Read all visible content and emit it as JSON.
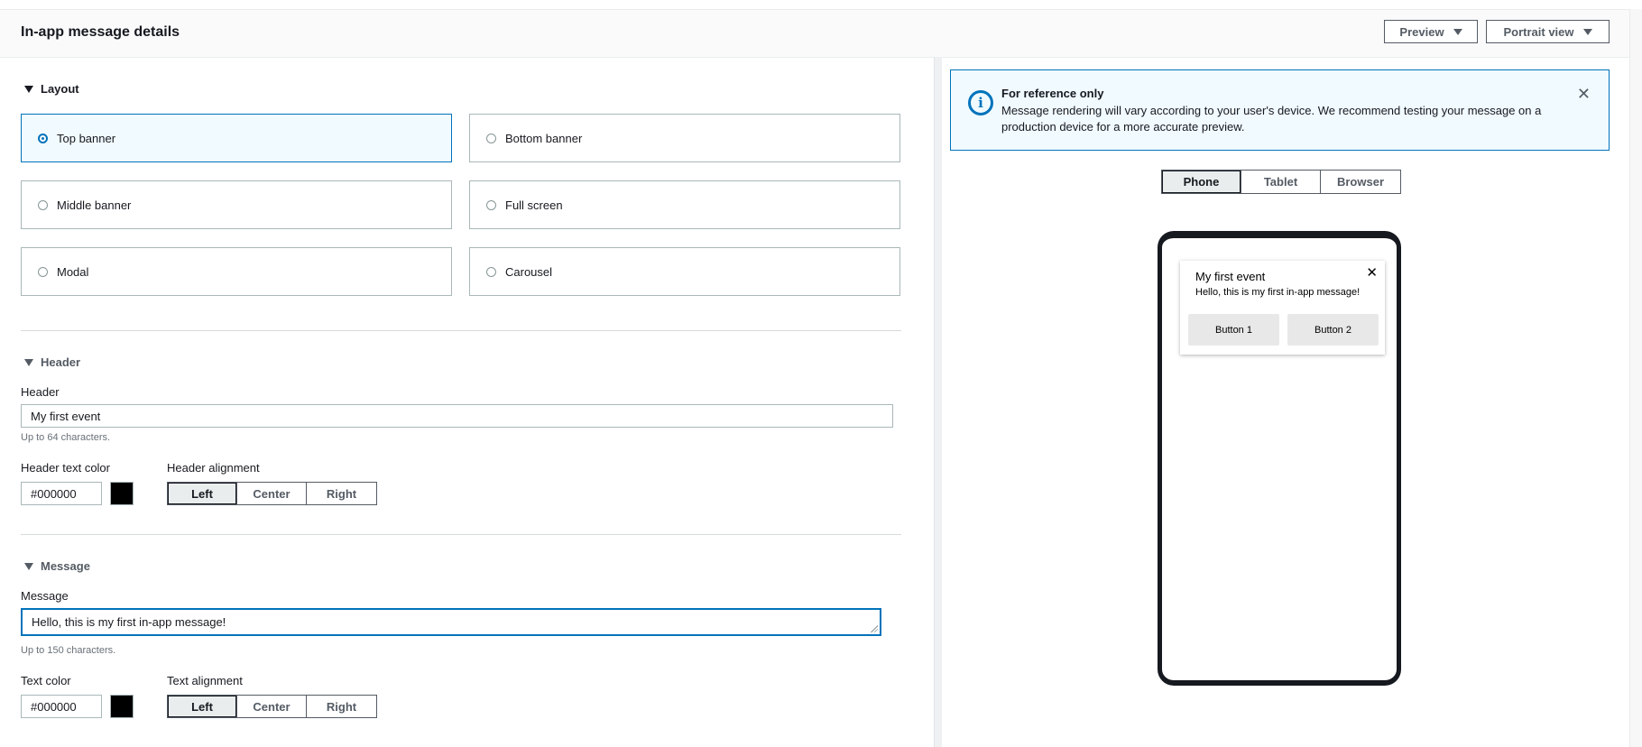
{
  "header": {
    "title": "In-app message details",
    "preview_label": "Preview",
    "view_label": "Portrait view"
  },
  "layout": {
    "section_label": "Layout",
    "options": [
      "Top banner",
      "Bottom banner",
      "Middle banner",
      "Full screen",
      "Modal",
      "Carousel"
    ],
    "selected": "Top banner"
  },
  "header_section": {
    "section_label": "Header",
    "field_label": "Header",
    "value": "My first event",
    "hint": "Up to 64 characters.",
    "color_label": "Header text color",
    "color_value": "#000000",
    "alignment_label": "Header alignment",
    "alignment_options": [
      "Left",
      "Center",
      "Right"
    ],
    "alignment_selected": "Left"
  },
  "message_section": {
    "section_label": "Message",
    "field_label": "Message",
    "value": "Hello, this is my first in-app message!",
    "hint": "Up to 150 characters.",
    "color_label": "Text color",
    "color_value": "#000000",
    "alignment_label": "Text alignment",
    "alignment_options": [
      "Left",
      "Center",
      "Right"
    ],
    "alignment_selected": "Left"
  },
  "alert": {
    "title": "For reference only",
    "body": "Message rendering will vary according to your user's device. We recommend testing your message on a production device for a more accurate preview.",
    "icon": "info-icon"
  },
  "device_tabs": {
    "options": [
      "Phone",
      "Tablet",
      "Browser"
    ],
    "selected": "Phone"
  },
  "preview_message": {
    "header": "My first event",
    "body": "Hello, this is my first in-app message!",
    "button1": "Button 1",
    "button2": "Button 2"
  },
  "colors": {
    "accent": "#0073bb",
    "selected_bg": "#f1faff",
    "swatch": "#000000"
  }
}
